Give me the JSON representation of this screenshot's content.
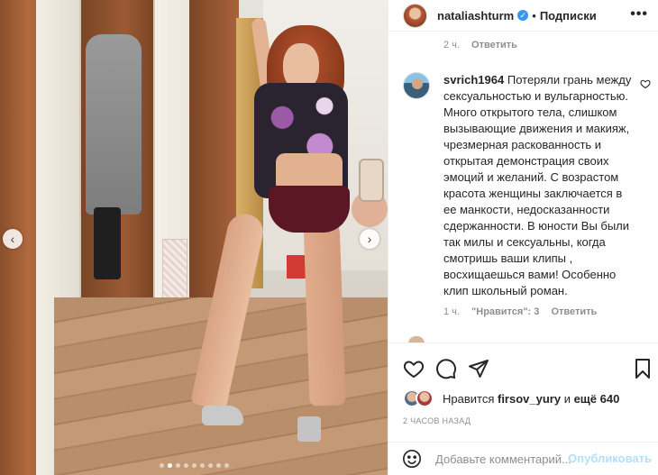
{
  "post": {
    "author": "nataliashturm",
    "verified_icon": "verified-badge-icon",
    "separator": "•",
    "follow_state": "Подписки",
    "more_icon": "more-horizontal-icon",
    "more_label": "•••"
  },
  "previous_comment": {
    "time": "2 ч.",
    "reply_label": "Ответить"
  },
  "comment": {
    "username": "svrich1964",
    "text": "Потеряли грань между сексуальностью и вульгарностью. Много открытого тела, слишком вызывающие движения и макияж, чрезмерная раскованность и открытая демонстрация своих эмоций и желаний. С возрастом красота женщины заключается в ее манкости, недосказанности сдержанности. В юности Вы были так милы и сексуальны, когда смотришь ваши клипы , восхищаешься вами! Особенно клип школьный роман.",
    "time": "1 ч.",
    "likes": "\"Нравится\": 3",
    "reply_label": "Ответить",
    "like_icon": "heart-icon"
  },
  "actions": {
    "like_icon": "heart-icon",
    "comment_icon": "comment-icon",
    "share_icon": "send-icon",
    "save_icon": "bookmark-icon"
  },
  "likes": {
    "prefix": "Нравится ",
    "user": "firsov_yury",
    "middle": " и ",
    "others": "ещё 640"
  },
  "time_ago": "2 ЧАСОВ НАЗАД",
  "composer": {
    "placeholder": "Добавьте комментарий...",
    "publish_label": "Опубликовать",
    "emoji_icon": "smiley-icon"
  },
  "carousel": {
    "prev_icon": "chevron-left-icon",
    "next_icon": "chevron-right-icon",
    "prev_label": "‹",
    "next_label": "›",
    "dot_count": 9,
    "active_index": 1
  },
  "colors": {
    "accent": "#3897f0",
    "publish_disabled": "#b2dffc",
    "meta": "#8e8e8e",
    "text": "#262626"
  }
}
